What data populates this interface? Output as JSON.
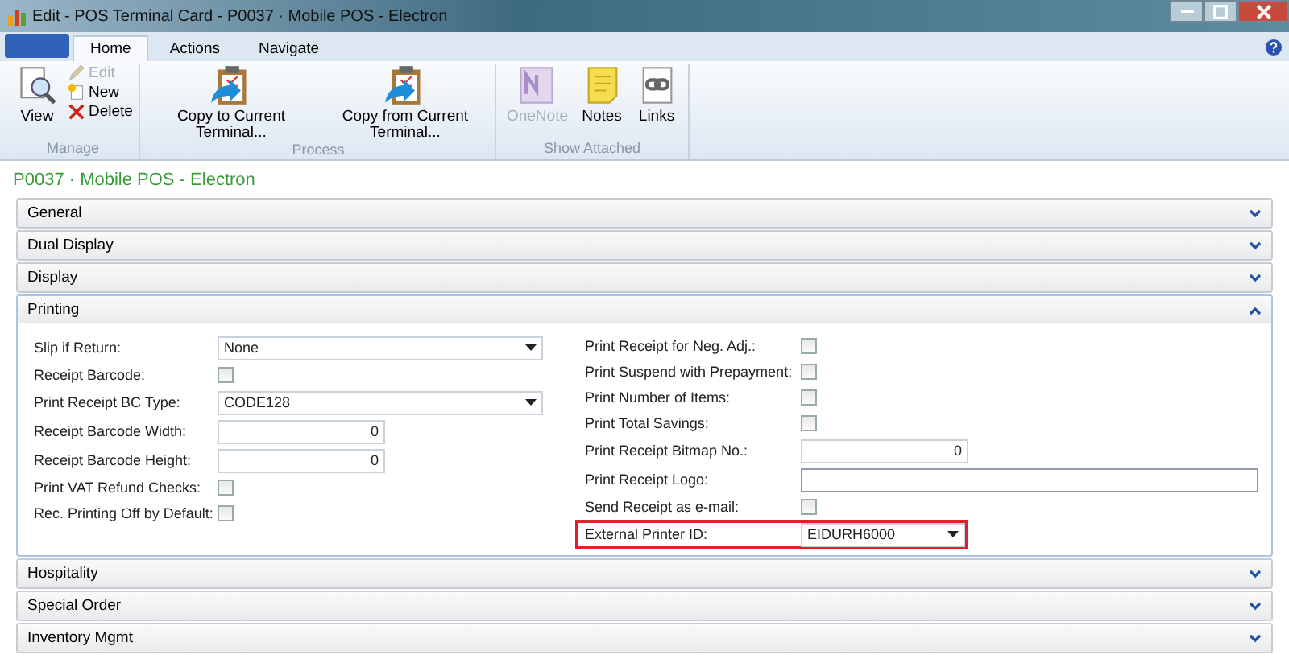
{
  "window": {
    "title": "Edit - POS Terminal Card - P0037 · Mobile POS - Electron"
  },
  "ribbon": {
    "tabs": [
      {
        "label": "Home",
        "selected": true
      },
      {
        "label": "Actions",
        "selected": false
      },
      {
        "label": "Navigate",
        "selected": false
      }
    ],
    "groups": [
      {
        "label": "Manage",
        "buttons": [
          {
            "label": "View",
            "kind": "large",
            "disabled": false
          },
          {
            "label": "Edit",
            "kind": "small",
            "disabled": true
          },
          {
            "label": "New",
            "kind": "small",
            "disabled": false
          },
          {
            "label": "Delete",
            "kind": "small",
            "disabled": false
          }
        ]
      },
      {
        "label": "Process",
        "buttons": [
          {
            "label": "Copy to Current Terminal...",
            "kind": "large",
            "disabled": false
          },
          {
            "label": "Copy from Current Terminal...",
            "kind": "large",
            "disabled": false
          }
        ]
      },
      {
        "label": "Show Attached",
        "buttons": [
          {
            "label": "OneNote",
            "kind": "large",
            "disabled": true
          },
          {
            "label": "Notes",
            "kind": "large",
            "disabled": false
          },
          {
            "label": "Links",
            "kind": "large",
            "disabled": false
          }
        ]
      }
    ]
  },
  "page_title": "P0037 · Mobile POS - Electron",
  "sections": [
    {
      "title": "General",
      "expanded": false
    },
    {
      "title": "Dual Display",
      "expanded": false
    },
    {
      "title": "Display",
      "expanded": false
    },
    {
      "title": "Printing",
      "expanded": true,
      "columns": [
        [
          {
            "label": "Slip if Return:",
            "kind": "dropdown",
            "value": "None"
          },
          {
            "label": "Receipt Barcode:",
            "kind": "checkbox",
            "checked": false
          },
          {
            "label": "Print Receipt BC Type:",
            "kind": "dropdown",
            "value": "CODE128"
          },
          {
            "label": "Receipt Barcode Width:",
            "kind": "number",
            "value": "0"
          },
          {
            "label": "Receipt Barcode Height:",
            "kind": "number",
            "value": "0"
          },
          {
            "label": "Print VAT Refund Checks:",
            "kind": "checkbox",
            "checked": false
          },
          {
            "label": "Rec. Printing Off by Default:",
            "kind": "checkbox",
            "checked": false
          }
        ],
        [
          {
            "label": "Print Receipt for Neg. Adj.:",
            "kind": "checkbox",
            "checked": false
          },
          {
            "label": "Print Suspend with Prepayment:",
            "kind": "checkbox",
            "checked": false
          },
          {
            "label": "Print Number of Items:",
            "kind": "checkbox",
            "checked": false
          },
          {
            "label": "Print Total Savings:",
            "kind": "checkbox",
            "checked": false
          },
          {
            "label": "Print Receipt Bitmap No.:",
            "kind": "number",
            "value": "0"
          },
          {
            "label": "Print Receipt Logo:",
            "kind": "text"
          },
          {
            "label": "Send Receipt as e-mail:",
            "kind": "checkbox",
            "checked": false
          },
          {
            "label": "External Printer ID:",
            "kind": "dropdown",
            "value": "EIDURH6000",
            "highlighted": true
          }
        ]
      ]
    },
    {
      "title": "Hospitality",
      "expanded": false
    },
    {
      "title": "Special Order",
      "expanded": false
    },
    {
      "title": "Inventory Mgmt",
      "expanded": false
    }
  ]
}
